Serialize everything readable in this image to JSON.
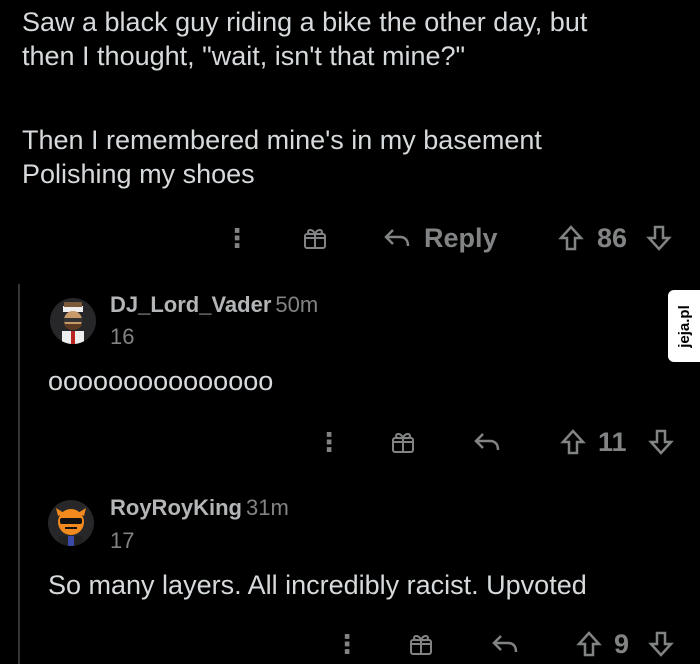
{
  "post": {
    "paragraph1_line1": "Saw a black guy riding a bike the other day, but",
    "paragraph1_line2": "then I thought, \"wait, isn't that mine?\"",
    "paragraph2_line1": "Then I remembered mine's in my basement",
    "paragraph2_line2": "Polishing my shoes",
    "actions": {
      "more_glyph": "⋮",
      "reply_label": "Reply",
      "upvotes": "86"
    }
  },
  "replies": [
    {
      "username": "DJ_Lord_Vader",
      "time": "50m",
      "score": "16",
      "body": "ooooooooooooooo",
      "upvotes": "11"
    },
    {
      "username": "RoyRoyKing",
      "time": "31m",
      "score": "17",
      "body": "So many layers. All incredibly racist. Upvoted",
      "upvotes": "9"
    }
  ],
  "watermark": {
    "text": "jeja.pl"
  },
  "icons": {
    "more": "more-options-icon",
    "award": "award-icon",
    "reply": "reply-arrow-icon",
    "upvote": "upvote-arrow-icon",
    "downvote": "downvote-arrow-icon"
  },
  "colors": {
    "background": "#000000",
    "text": "#d7dadc",
    "muted": "#818384",
    "thread_line": "#343536"
  }
}
